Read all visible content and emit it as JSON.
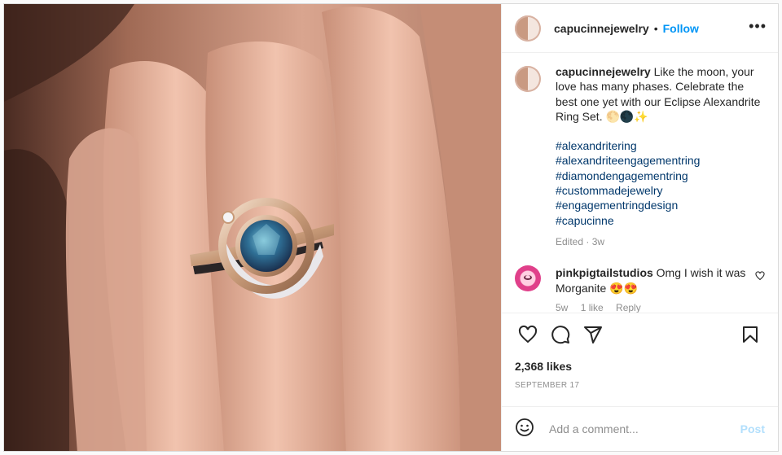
{
  "post": {
    "username": "capucinnejewelry",
    "follow_label": "Follow",
    "separator": "•",
    "more_label": "•••",
    "caption": "Like the moon, your love has many phases. Celebrate the best one yet with our Eclipse Alexandrite Ring Set. 🌕🌑✨",
    "hashtags": [
      "#alexandritering",
      "#alexandriteengagementring",
      "#diamondengagementring",
      "#custommadejewelry",
      "#engagementringdesign",
      "#capucinne"
    ],
    "edited_label": "Edited · 3w",
    "likes": "2,368 likes",
    "date": "SEPTEMBER 17"
  },
  "comments": [
    {
      "username": "pinkpigtailstudios",
      "text": "Omg I wish it was Morganite 😍😍",
      "age": "5w",
      "likes": "1 like",
      "reply_label": "Reply"
    }
  ],
  "composer": {
    "placeholder": "Add a comment...",
    "post_label": "Post"
  },
  "icons": {
    "like": "heart-icon",
    "comment": "comment-bubble-icon",
    "share": "paper-plane-icon",
    "save": "bookmark-icon",
    "emoji": "smiley-icon",
    "comment_like": "heart-icon"
  },
  "colors": {
    "follow": "#0095f6",
    "hashtag": "#00376b",
    "post_disabled": "#b2dffc",
    "meta": "#8e8e8e"
  }
}
